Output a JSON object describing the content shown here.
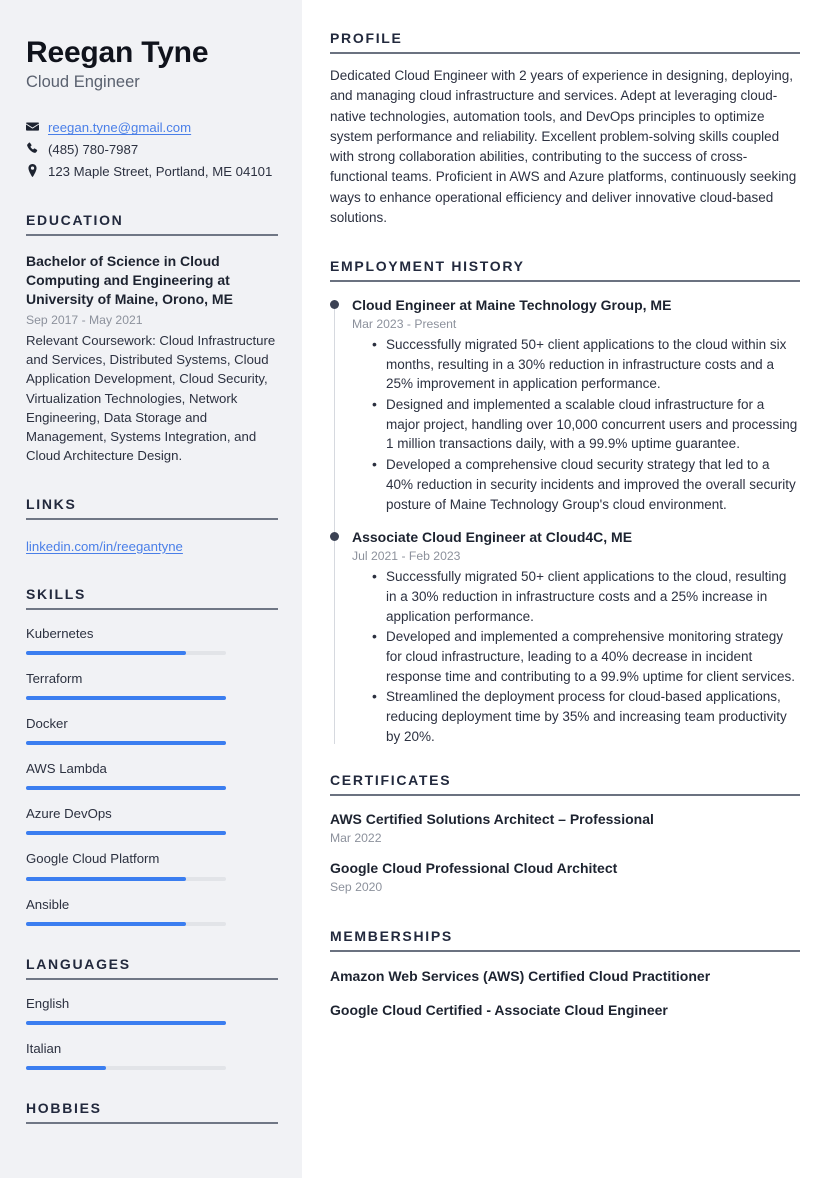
{
  "sidebar": {
    "name": "Reegan Tyne",
    "job_title": "Cloud Engineer",
    "contact": {
      "email": "reegan.tyne@gmail.com",
      "phone": "(485) 780-7987",
      "address": "123 Maple Street, Portland, ME 04101"
    },
    "education": {
      "heading": "EDUCATION",
      "degree": "Bachelor of Science in Cloud Computing and Engineering at University of Maine, Orono, ME",
      "date": "Sep 2017 - May 2021",
      "description": "Relevant Coursework: Cloud Infrastructure and Services, Distributed Systems, Cloud Application Development, Cloud Security, Virtualization Technologies, Network Engineering, Data Storage and Management, Systems Integration, and Cloud Architecture Design."
    },
    "links": {
      "heading": "LINKS",
      "items": [
        {
          "label": "linkedin.com/in/reegantyne"
        }
      ]
    },
    "skills": {
      "heading": "SKILLS",
      "items": [
        {
          "label": "Kubernetes",
          "level": 80
        },
        {
          "label": "Terraform",
          "level": 100
        },
        {
          "label": "Docker",
          "level": 100
        },
        {
          "label": "AWS Lambda",
          "level": 100
        },
        {
          "label": "Azure DevOps",
          "level": 100
        },
        {
          "label": "Google Cloud Platform",
          "level": 80
        },
        {
          "label": "Ansible",
          "level": 80
        }
      ]
    },
    "languages": {
      "heading": "LANGUAGES",
      "items": [
        {
          "label": "English",
          "level": 100
        },
        {
          "label": "Italian",
          "level": 40
        }
      ]
    },
    "hobbies": {
      "heading": "HOBBIES"
    }
  },
  "main": {
    "profile": {
      "heading": "PROFILE",
      "text": "Dedicated Cloud Engineer with 2 years of experience in designing, deploying, and managing cloud infrastructure and services. Adept at leveraging cloud-native technologies, automation tools, and DevOps principles to optimize system performance and reliability. Excellent problem-solving skills coupled with strong collaboration abilities, contributing to the success of cross-functional teams. Proficient in AWS and Azure platforms, continuously seeking ways to enhance operational efficiency and deliver innovative cloud-based solutions."
    },
    "employment": {
      "heading": "EMPLOYMENT HISTORY",
      "jobs": [
        {
          "title": "Cloud Engineer at Maine Technology Group, ME",
          "date": "Mar 2023 - Present",
          "bullets": [
            "Successfully migrated 50+ client applications to the cloud within six months, resulting in a 30% reduction in infrastructure costs and a 25% improvement in application performance.",
            "Designed and implemented a scalable cloud infrastructure for a major project, handling over 10,000 concurrent users and processing 1 million transactions daily, with a 99.9% uptime guarantee.",
            "Developed a comprehensive cloud security strategy that led to a 40% reduction in security incidents and improved the overall security posture of Maine Technology Group's cloud environment."
          ]
        },
        {
          "title": "Associate Cloud Engineer at Cloud4C, ME",
          "date": "Jul 2021 - Feb 2023",
          "bullets": [
            "Successfully migrated 50+ client applications to the cloud, resulting in a 30% reduction in infrastructure costs and a 25% increase in application performance.",
            "Developed and implemented a comprehensive monitoring strategy for cloud infrastructure, leading to a 40% decrease in incident response time and contributing to a 99.9% uptime for client services.",
            "Streamlined the deployment process for cloud-based applications, reducing deployment time by 35% and increasing team productivity by 20%."
          ]
        }
      ]
    },
    "certificates": {
      "heading": "CERTIFICATES",
      "items": [
        {
          "title": "AWS Certified Solutions Architect – Professional",
          "date": "Mar 2022"
        },
        {
          "title": "Google Cloud Professional Cloud Architect",
          "date": "Sep 2020"
        }
      ]
    },
    "memberships": {
      "heading": "MEMBERSHIPS",
      "items": [
        {
          "title": "Amazon Web Services (AWS) Certified Cloud Practitioner"
        },
        {
          "title": "Google Cloud Certified - Associate Cloud Engineer"
        }
      ]
    }
  },
  "colors": {
    "accent": "#3b7ef0",
    "link": "#4a7fe8",
    "heading": "#22293d",
    "sidebar_bg": "#f1f2f5",
    "muted": "#8c919c"
  }
}
